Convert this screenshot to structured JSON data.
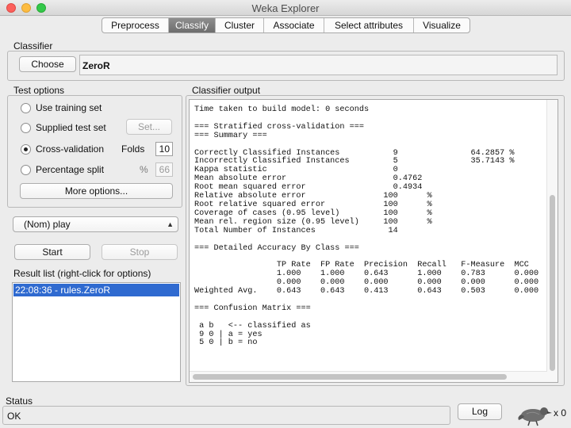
{
  "window": {
    "title": "Weka Explorer"
  },
  "tabs": [
    {
      "label": "Preprocess"
    },
    {
      "label": "Classify"
    },
    {
      "label": "Cluster"
    },
    {
      "label": "Associate"
    },
    {
      "label": "Select attributes"
    },
    {
      "label": "Visualize"
    }
  ],
  "classifier": {
    "group_label": "Classifier",
    "choose_label": "Choose",
    "name": "ZeroR"
  },
  "test_options": {
    "group_label": "Test options",
    "use_training_set": "Use training set",
    "supplied_test_set": "Supplied test set",
    "set_button": "Set...",
    "cross_validation": "Cross-validation",
    "folds_label": "Folds",
    "folds_value": "10",
    "percentage_split": "Percentage split",
    "percent_symbol": "%",
    "percentage_value": "66",
    "more_options": "More options...",
    "selected": "cross_validation"
  },
  "class_select": {
    "value": "(Nom) play"
  },
  "actions": {
    "start": "Start",
    "stop": "Stop"
  },
  "result_list": {
    "label": "Result list (right-click for options)",
    "items": [
      "22:08:36 - rules.ZeroR"
    ]
  },
  "output": {
    "label": "Classifier output",
    "text": "Time taken to build model: 0 seconds\n\n=== Stratified cross-validation ===\n=== Summary ===\n\nCorrectly Classified Instances           9               64.2857 %\nIncorrectly Classified Instances         5               35.7143 %\nKappa statistic                          0\nMean absolute error                      0.4762\nRoot mean squared error                  0.4934\nRelative absolute error                100      %\nRoot relative squared error            100      %\nCoverage of cases (0.95 level)         100      %\nMean rel. region size (0.95 level)     100      %\nTotal Number of Instances               14\n\n=== Detailed Accuracy By Class ===\n\n                 TP Rate  FP Rate  Precision  Recall   F-Measure  MCC\n                 1.000    1.000    0.643      1.000    0.783      0.000\n                 0.000    0.000    0.000      0.000    0.000      0.000\nWeighted Avg.    0.643    0.643    0.413      0.643    0.503      0.000\n\n=== Confusion Matrix ===\n\n a b   <-- classified as\n 9 0 | a = yes\n 5 0 | b = no"
  },
  "status": {
    "label": "Status",
    "text": "OK",
    "log_button": "Log",
    "task_count": "x 0"
  },
  "icons": {
    "bird": "weka-bird-icon"
  }
}
